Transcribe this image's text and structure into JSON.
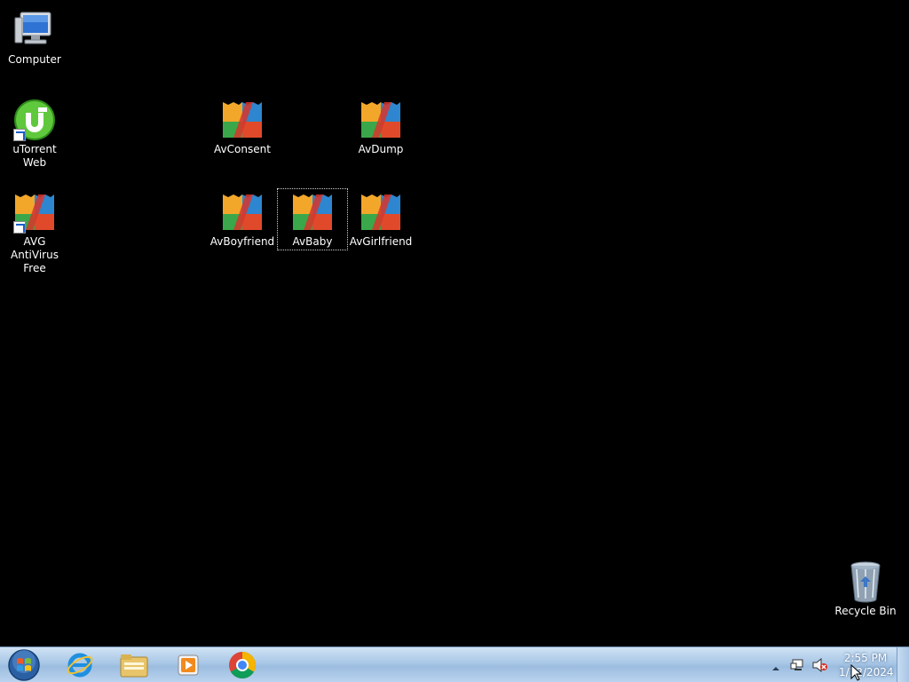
{
  "desktop": {
    "icons": {
      "computer": {
        "label": "Computer",
        "icon": "computer-icon"
      },
      "utorrent": {
        "label": "uTorrent Web",
        "icon": "utorrent-icon"
      },
      "avg": {
        "label": "AVG AntiVirus Free",
        "icon": "avg-icon"
      },
      "avconsent": {
        "label": "AvConsent",
        "icon": "avg-icon"
      },
      "avdump": {
        "label": "AvDump",
        "icon": "avg-icon"
      },
      "avboyfriend": {
        "label": "AvBoyfriend",
        "icon": "avg-icon"
      },
      "avbaby": {
        "label": "AvBaby",
        "icon": "avg-icon",
        "selected": true
      },
      "avgirlfriend": {
        "label": "AvGirlfriend",
        "icon": "avg-icon"
      },
      "recycle": {
        "label": "Recycle Bin",
        "icon": "recycle-bin-icon"
      }
    }
  },
  "taskbar": {
    "start": {
      "icon": "windows-start-orb-icon"
    },
    "pinned": [
      "internet-explorer-icon",
      "file-explorer-icon",
      "media-player-icon",
      "chrome-icon"
    ],
    "tray": [
      "show-hidden-icons-chevron",
      "network-icon",
      "volume-muted-icon"
    ],
    "clock": {
      "time": "2:55 PM",
      "date": "1/12/2024"
    }
  },
  "colors": {
    "desktop": "#000000",
    "taskbar": "#a9c7e6",
    "label": "#ffffff"
  }
}
